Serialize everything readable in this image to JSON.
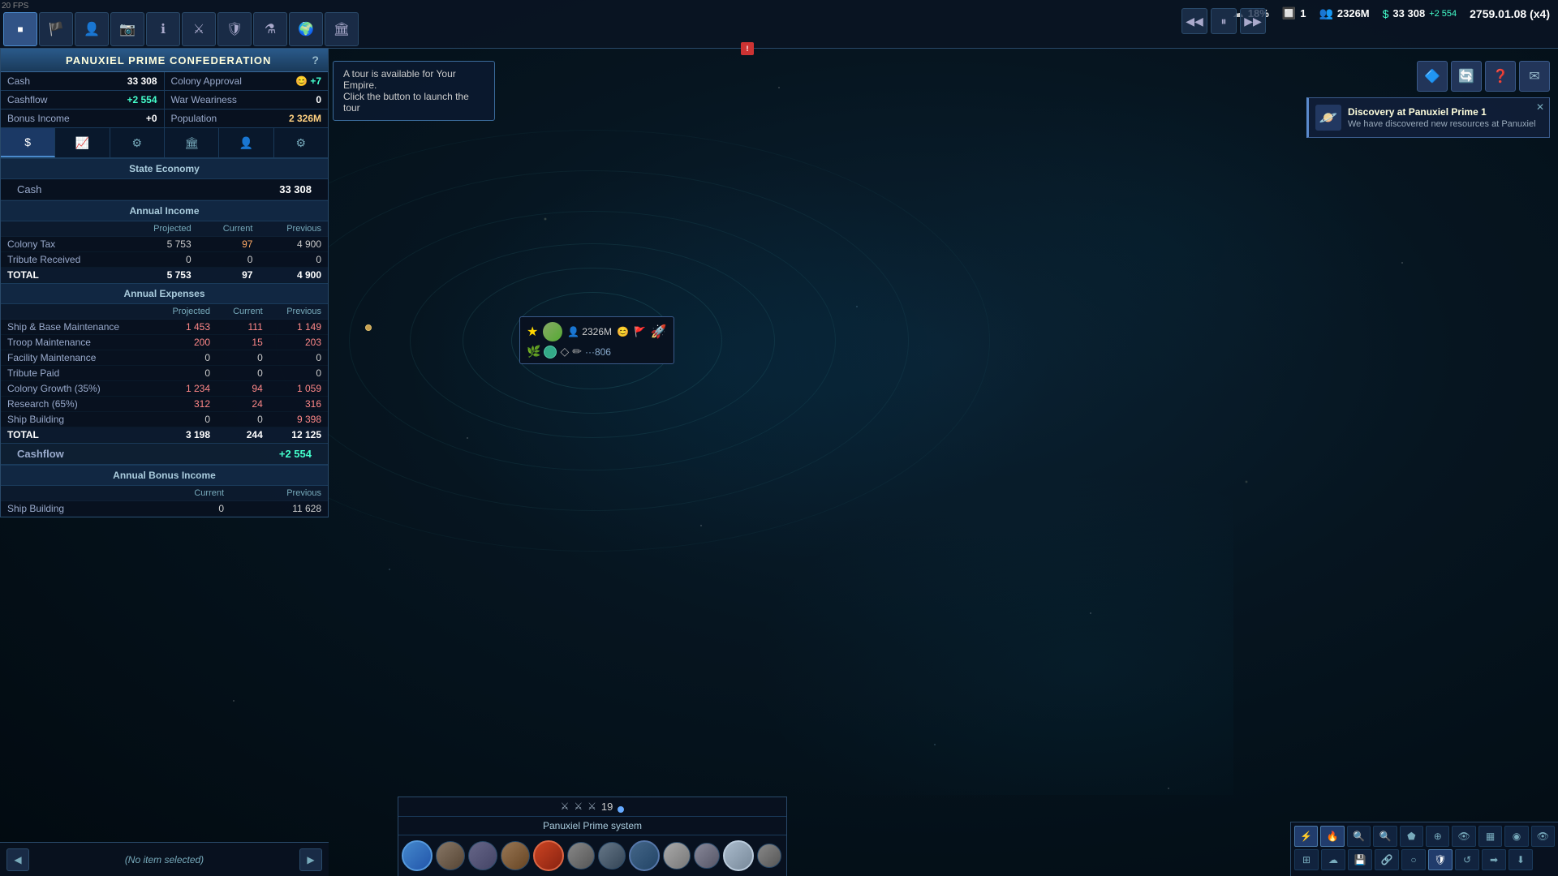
{
  "fps": "20 FPS",
  "toolbar": {
    "buttons": [
      {
        "id": "home",
        "icon": "⬜",
        "active": true
      },
      {
        "id": "flag",
        "icon": "🏴"
      },
      {
        "id": "people",
        "icon": "👤"
      },
      {
        "id": "camera",
        "icon": "📷"
      },
      {
        "id": "info",
        "icon": "ℹ"
      },
      {
        "id": "sword",
        "icon": "⚔"
      },
      {
        "id": "shield",
        "icon": "🛡"
      },
      {
        "id": "flask",
        "icon": "⚗"
      },
      {
        "id": "planet",
        "icon": "🌍"
      },
      {
        "id": "empire",
        "icon": "🏛"
      }
    ]
  },
  "top_stats": {
    "cloud_pct": "18%",
    "fleet_count": "1",
    "population": "2326M",
    "cash": "33 308",
    "cashflow": "+2 554",
    "date": "2759.01.08 (x4)"
  },
  "speed_controls": {
    "prev": "◀◀",
    "pause": "⏸",
    "next": "▶▶"
  },
  "action_buttons": [
    "🔷",
    "🔄",
    "❓",
    "✉"
  ],
  "panel": {
    "title": "PANUXIEL PRIME CONFEDERATION",
    "close": "?",
    "summary": {
      "cash_label": "Cash",
      "cash_value": "33 308",
      "colony_approval_label": "Colony Approval",
      "colony_approval_value": "+7",
      "cashflow_label": "Cashflow",
      "cashflow_value": "+2 554",
      "war_weariness_label": "War Weariness",
      "war_weariness_value": "0",
      "bonus_income_label": "Bonus Income",
      "bonus_income_value": "+0",
      "population_label": "Population",
      "population_value": "2 326M"
    },
    "tabs": [
      "$",
      "📈",
      "⚙",
      "🏛",
      "👤",
      "⚙"
    ],
    "active_tab": 0,
    "economy": {
      "section": "State Economy",
      "cash_label": "Cash",
      "cash_amount": "33 308",
      "annual_income": {
        "header": "Annual Income",
        "columns": [
          "",
          "Projected",
          "Current",
          "Previous"
        ],
        "rows": [
          {
            "label": "Colony Tax",
            "projected": "5 753",
            "current": "97",
            "previous": "4 900",
            "current_class": "orange"
          },
          {
            "label": "Tribute Received",
            "projected": "0",
            "current": "0",
            "previous": "0"
          },
          {
            "label": "TOTAL",
            "projected": "5 753",
            "current": "97",
            "previous": "4 900",
            "is_total": true
          }
        ]
      },
      "annual_expenses": {
        "header": "Annual Expenses",
        "columns": [
          "",
          "Projected",
          "Current",
          "Previous"
        ],
        "rows": [
          {
            "label": "Ship & Base Maintenance",
            "projected": "1 453",
            "current": "111",
            "previous": "1 149",
            "projected_class": "red",
            "current_class": "red",
            "previous_class": "red"
          },
          {
            "label": "Troop Maintenance",
            "projected": "200",
            "current": "15",
            "previous": "203",
            "projected_class": "red",
            "current_class": "red",
            "previous_class": "red"
          },
          {
            "label": "Facility Maintenance",
            "projected": "0",
            "current": "0",
            "previous": "0"
          },
          {
            "label": "Tribute Paid",
            "projected": "0",
            "current": "0",
            "previous": "0"
          },
          {
            "label": "Colony Growth (35%)",
            "projected": "1 234",
            "current": "94",
            "previous": "1 059",
            "projected_class": "red",
            "current_class": "red",
            "previous_class": "red"
          },
          {
            "label": "Research (65%)",
            "projected": "312",
            "current": "24",
            "previous": "316",
            "projected_class": "red",
            "current_class": "red",
            "previous_class": "red"
          },
          {
            "label": "Ship Building",
            "projected": "0",
            "current": "0",
            "previous": "9 398",
            "previous_class": "red"
          },
          {
            "label": "TOTAL",
            "projected": "3 198",
            "current": "244",
            "previous": "12 125",
            "is_total": true,
            "projected_class": "red",
            "current_class": "red",
            "previous_class": "red"
          }
        ]
      },
      "cashflow_label": "Cashflow",
      "cashflow_value": "+2 554",
      "bonus_income": {
        "header": "Annual Bonus Income",
        "columns": [
          "",
          "Current",
          "Previous"
        ],
        "rows": [
          {
            "label": "Ship Building",
            "current": "0",
            "previous": "11 628"
          }
        ]
      }
    }
  },
  "tooltip": {
    "line1": "A tour is available for Your Empire.",
    "line2": "Click the button to launch the tour"
  },
  "notification": {
    "title": "Discovery at Panuxiel Prime 1",
    "body": "We have discovered new resources at Panuxiel"
  },
  "planet_popup": {
    "population": "2326M",
    "happiness": "😊",
    "flag_icon": "🚩",
    "ship_icon": "🚀",
    "dots": "···806"
  },
  "system": {
    "name": "Panuxiel Prime system",
    "tab_num": "19"
  },
  "bottom_nav": {
    "no_item": "(No item selected)"
  },
  "colors": {
    "bg_dark": "#080c14",
    "accent_blue": "#3a7acc",
    "accent_green": "#44ffcc",
    "accent_orange": "#ffaa44",
    "accent_red": "#ff6644",
    "text_light": "#ccdde8"
  }
}
